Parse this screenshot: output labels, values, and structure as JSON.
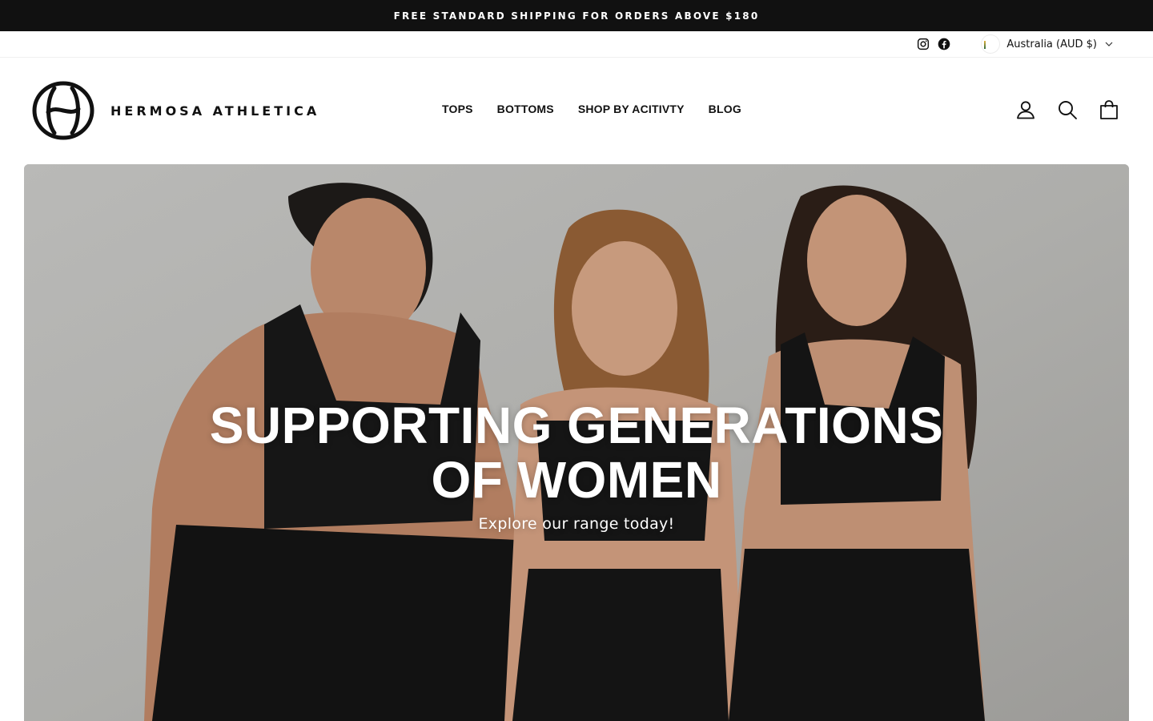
{
  "announcement": {
    "text": "FREE STANDARD SHIPPING FOR ORDERS ABOVE $180"
  },
  "utility": {
    "social": [
      {
        "icon": "instagram-icon",
        "label": "Instagram"
      },
      {
        "icon": "facebook-icon",
        "label": "Facebook"
      }
    ],
    "currency": {
      "label": "Australia (AUD $)",
      "flag_icon": "australia-flag-icon"
    }
  },
  "header": {
    "logo": {
      "text": "HERMOSA ATHLETICA",
      "icon": "hermosa-logo-mark"
    },
    "nav": [
      "TOPS",
      "BOTTOMS",
      "SHOP BY ACITIVTY",
      "BLOG"
    ],
    "icons": [
      "account-icon",
      "search-icon",
      "cart-icon"
    ]
  },
  "hero": {
    "title_line1": "SUPPORTING GENERATIONS",
    "title_line2": "OF WOMEN",
    "subtitle": "Explore our range today!",
    "image_alt": "Three women in black sports bras and leggings standing against a grey wall"
  },
  "colors": {
    "announcement_bg": "#111111",
    "text": "#111111",
    "hero_text": "#ffffff",
    "wall": "#b2b2b0"
  }
}
